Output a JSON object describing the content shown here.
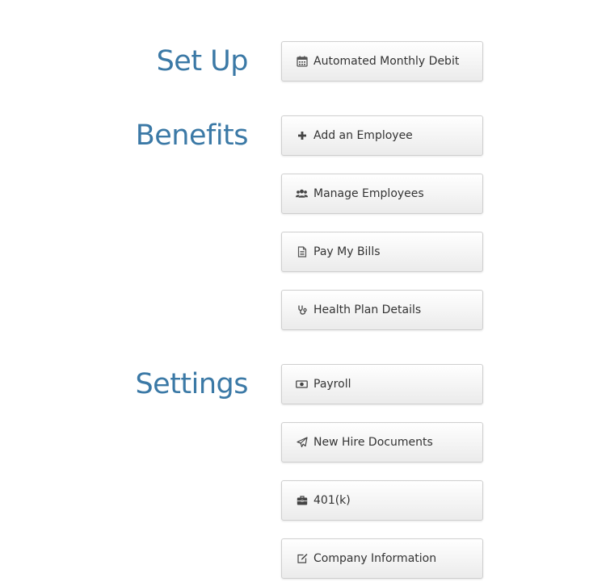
{
  "sections": {
    "setup": {
      "title": "Set Up",
      "items": [
        {
          "label": "Automated Monthly Debit",
          "icon": "calendar-icon"
        }
      ]
    },
    "benefits": {
      "title": "Benefits",
      "items": [
        {
          "label": "Add an Employee",
          "icon": "plus-icon"
        },
        {
          "label": "Manage Employees",
          "icon": "users-icon"
        },
        {
          "label": "Pay My Bills",
          "icon": "document-icon"
        },
        {
          "label": "Health Plan Details",
          "icon": "stethoscope-icon"
        }
      ]
    },
    "settings": {
      "title": "Settings",
      "items": [
        {
          "label": "Payroll",
          "icon": "money-icon"
        },
        {
          "label": "New Hire Documents",
          "icon": "paper-plane-icon"
        },
        {
          "label": "401(k)",
          "icon": "briefcase-icon"
        },
        {
          "label": "Company Information",
          "icon": "edit-icon"
        }
      ]
    }
  },
  "colors": {
    "heading": "#3b79a6",
    "button_text": "#333333",
    "button_border": "#cfcfcf"
  }
}
